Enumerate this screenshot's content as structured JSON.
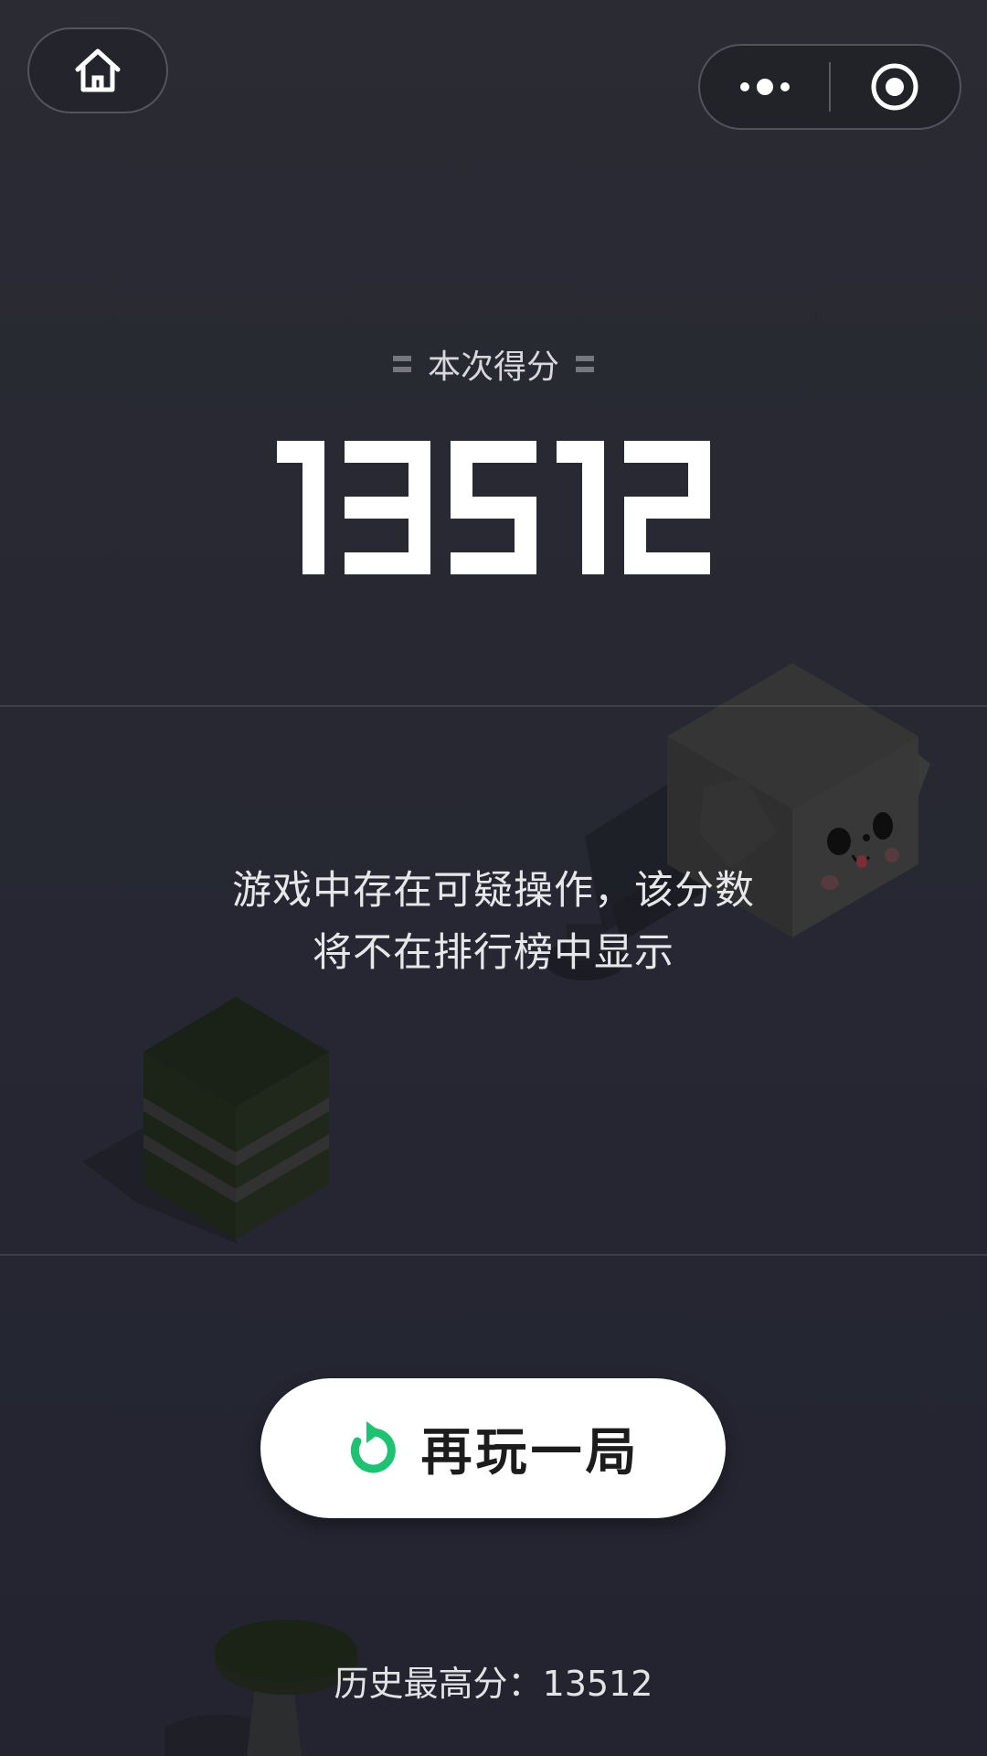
{
  "nav": {
    "home_icon": "home-icon",
    "more_icon": "more-dots-icon",
    "close_icon": "target-circle-icon"
  },
  "result": {
    "score_title": "本次得分",
    "score": "13512",
    "notice_line1": "游戏中存在可疑操作，该分数",
    "notice_line2": "将不在排行榜中显示"
  },
  "actions": {
    "replay_label": "再玩一局",
    "replay_icon": "refresh-icon"
  },
  "history": {
    "best_label": "历史最高分：",
    "best_score": "13512"
  },
  "colors": {
    "background": "#272833",
    "accent_green": "#1fc173",
    "button_bg": "#ffffff"
  }
}
